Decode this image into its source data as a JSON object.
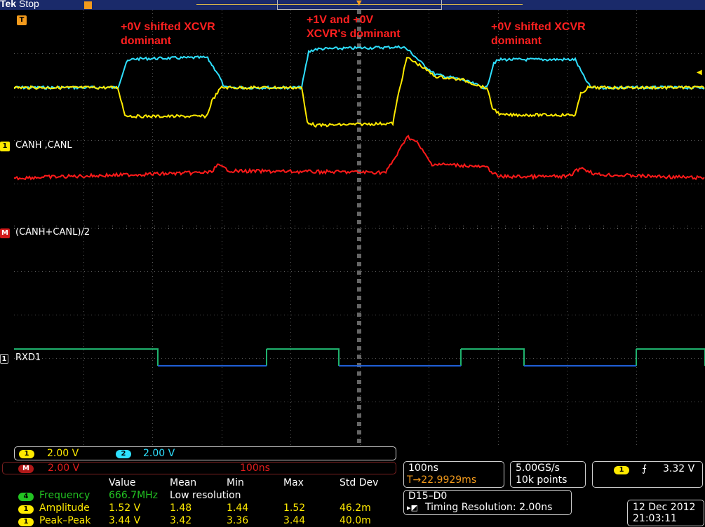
{
  "status": {
    "brand": "Tek",
    "run_state": "Stop"
  },
  "annotations": [
    {
      "text": "+0V shifted XCVR\ndominant"
    },
    {
      "text": "+1V and +0V\nXCVR's dominant"
    },
    {
      "text": "+0V shifted XCVR\ndominant"
    }
  ],
  "channels": {
    "ch1_label": "CANH ,CANL",
    "math_label": "(CANH+CANL)/2",
    "digital_label": "RXD1",
    "ch1_marker": "1",
    "math_marker": "M",
    "digital_marker": "1",
    "trigger_marker": "T"
  },
  "scale": {
    "ch1_num": "1",
    "ch1_scale": "2.00 V",
    "ch2_num": "2",
    "ch2_scale": "2.00 V",
    "math_num": "M",
    "math_scale": "2.00 V",
    "math_time": "100ns"
  },
  "timebase": {
    "horizontal": "100ns",
    "trigger_delay": "T→22.9929ms"
  },
  "acquisition": {
    "sample_rate": "5.00GS/s",
    "record_length": "10k points"
  },
  "trigger": {
    "source": "1",
    "slope_symbol": "ℱ",
    "level": "3.32 V"
  },
  "bus": {
    "name": "D15–D0",
    "timing_resolution": "Timing Resolution: 2.00ns"
  },
  "datetime": {
    "date": "12 Dec  2012",
    "time": "21:03:11"
  },
  "measurements": {
    "headers": [
      "Value",
      "Mean",
      "Min",
      "Max",
      "Std Dev"
    ],
    "rows": [
      {
        "src": "4",
        "name": "Frequency",
        "value": "666.7MHz",
        "mean": "Low resolution",
        "min": "",
        "max": "",
        "std": ""
      },
      {
        "src": "1",
        "name": "Amplitude",
        "value": "1.52 V",
        "mean": "1.48",
        "min": "1.44",
        "max": "1.52",
        "std": "46.2m"
      },
      {
        "src": "1",
        "name": "Peak–Peak",
        "value": "3.44 V",
        "mean": "3.42",
        "min": "3.36",
        "max": "3.44",
        "std": "40.0m"
      }
    ]
  },
  "colors": {
    "ch1": "#ffea00",
    "ch2": "#2ee0ff",
    "math": "#ff1a1a",
    "digital_high": "#1fb26e",
    "digital_low": "#1f5fd6",
    "trigger": "#f29a1c"
  }
}
